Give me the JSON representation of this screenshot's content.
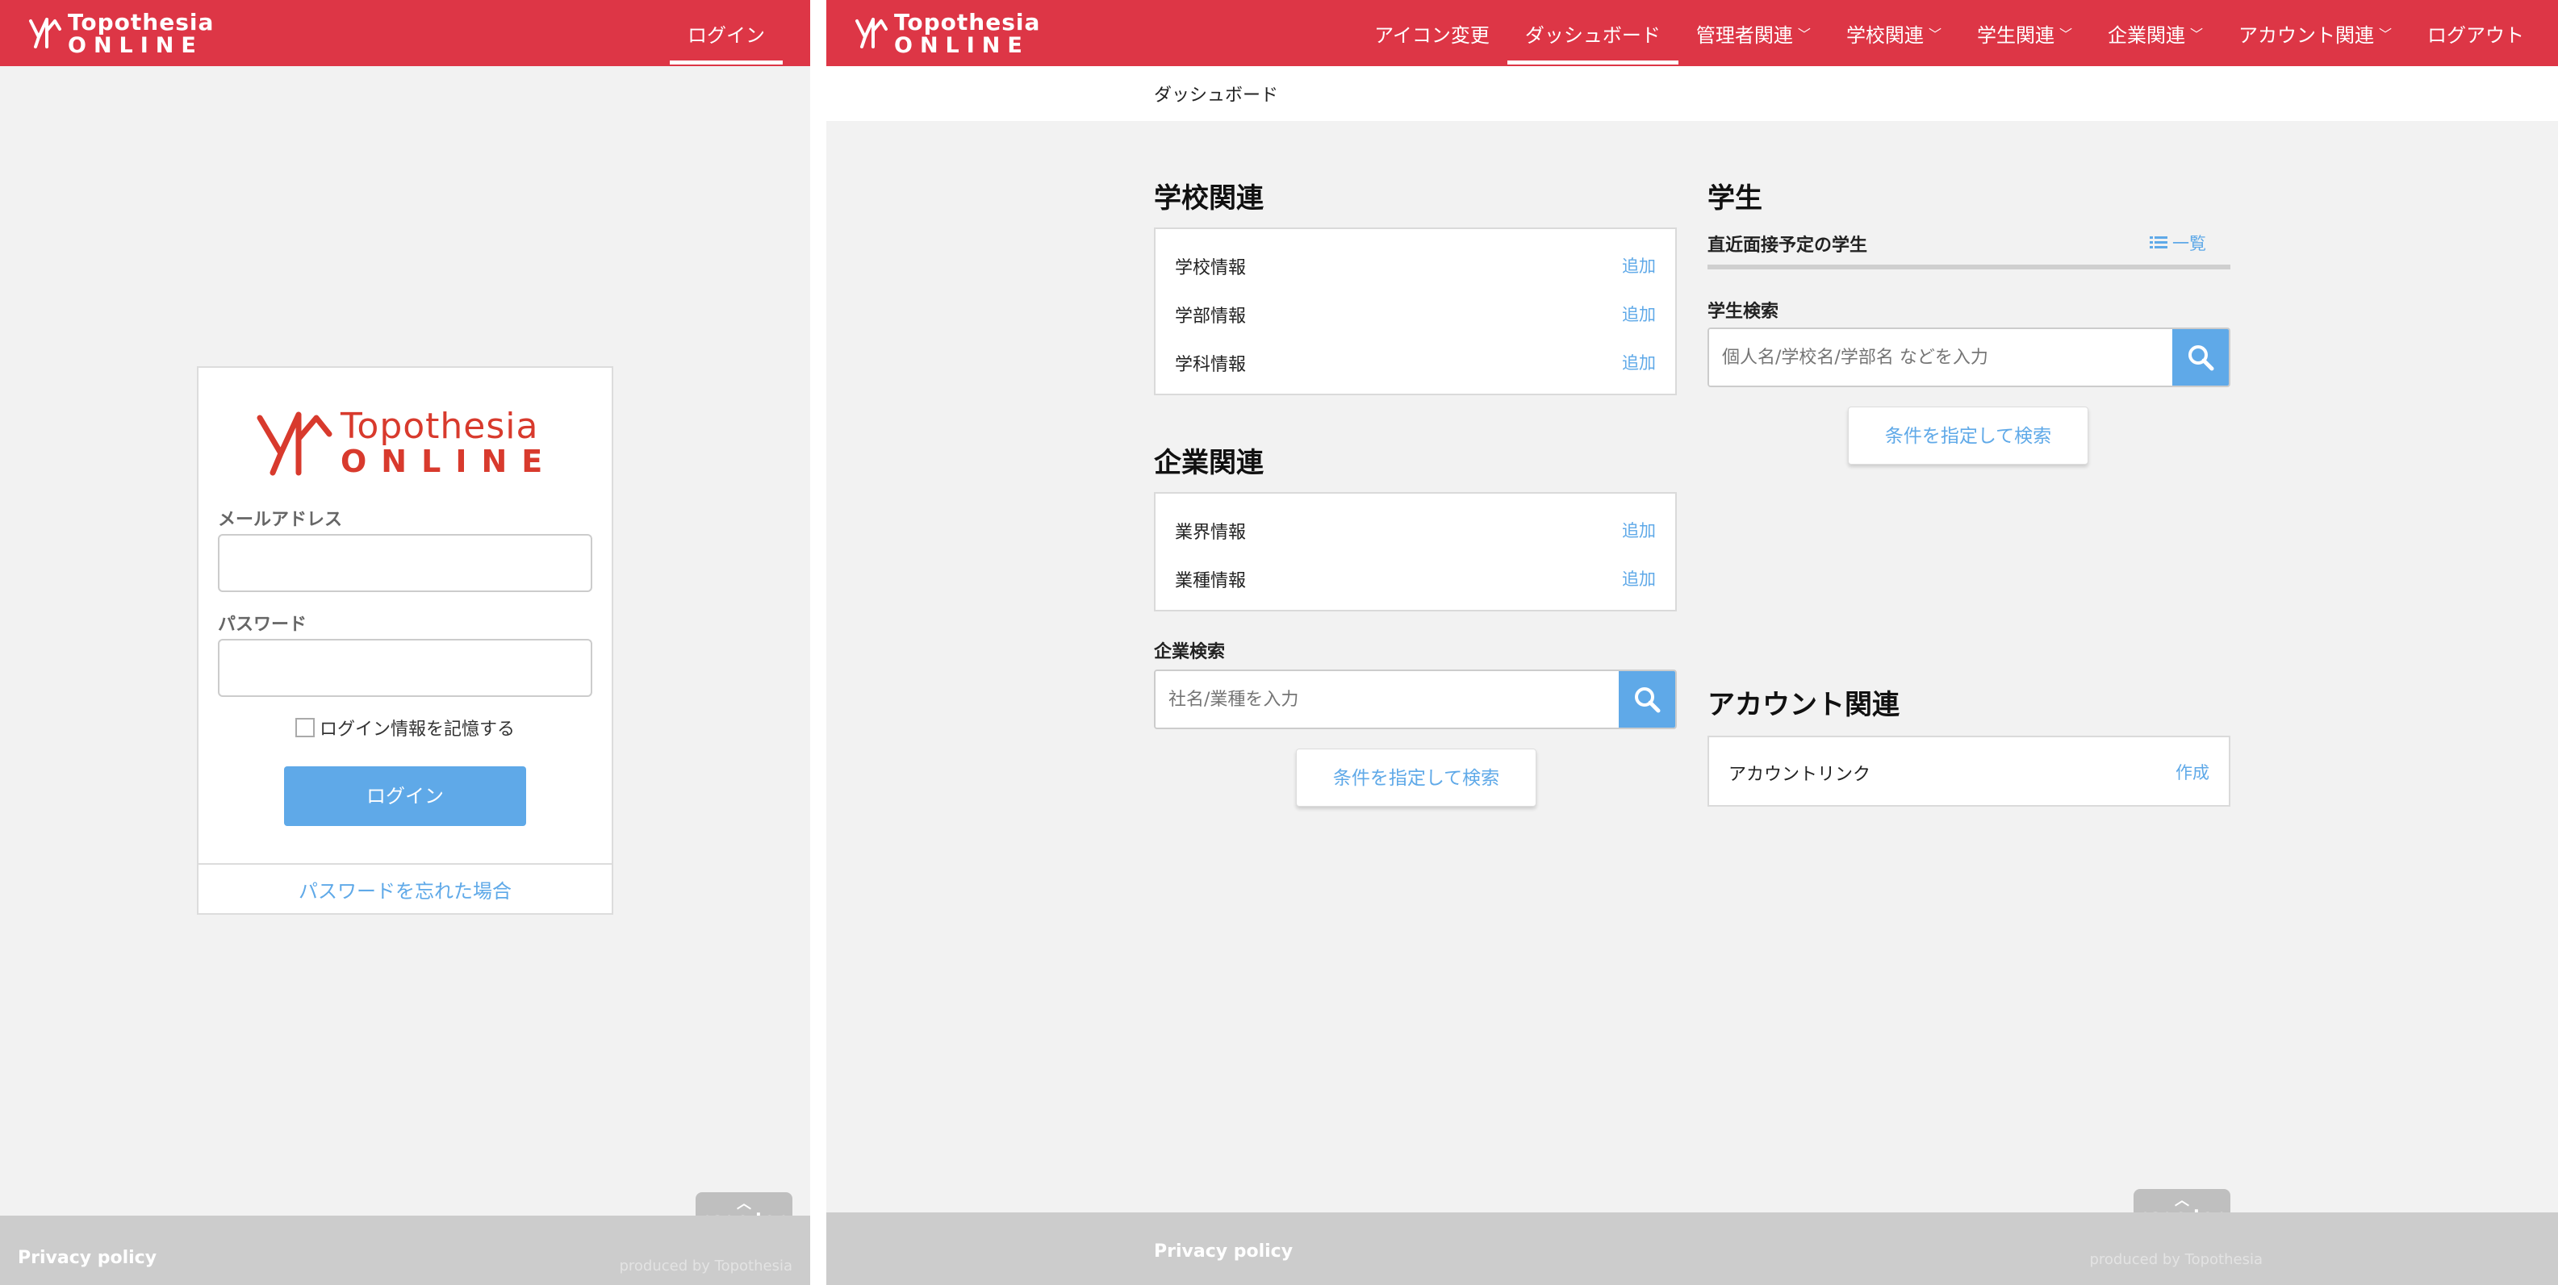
{
  "colors": {
    "brand": "#dd3646",
    "accent": "#5fa9e8",
    "background": "#f2f2f2",
    "footer": "#cccccc"
  },
  "login_page": {
    "header": {
      "logo_line1": "Topothesia",
      "logo_line2": "ONLINE",
      "nav_login": "ログイン"
    },
    "card": {
      "logo_line1": "Topothesia",
      "logo_line2": "ONLINE",
      "email_label": "メールアドレス",
      "email_value": "",
      "password_label": "パスワード",
      "password_value": "",
      "remember_label": "ログイン情報を記憶する",
      "login_button": "ログイン",
      "forgot_link": "パスワードを忘れた場合"
    },
    "page_top": "page top",
    "footer": {
      "privacy": "Privacy policy",
      "produced": "produced by Topothesia"
    }
  },
  "dashboard_page": {
    "header": {
      "logo_line1": "Topothesia",
      "logo_line2": "ONLINE",
      "nav": [
        {
          "label": "アイコン変更",
          "dropdown": false,
          "active": false
        },
        {
          "label": "ダッシュボード",
          "dropdown": false,
          "active": true
        },
        {
          "label": "管理者関連",
          "dropdown": true,
          "active": false
        },
        {
          "label": "学校関連",
          "dropdown": true,
          "active": false
        },
        {
          "label": "学生関連",
          "dropdown": true,
          "active": false
        },
        {
          "label": "企業関連",
          "dropdown": true,
          "active": false
        },
        {
          "label": "アカウント関連",
          "dropdown": true,
          "active": false
        },
        {
          "label": "ログアウト",
          "dropdown": false,
          "active": false
        }
      ]
    },
    "breadcrumb": "ダッシュボード",
    "school": {
      "title": "学校関連",
      "items": [
        {
          "label": "学校情報",
          "action": "追加"
        },
        {
          "label": "学部情報",
          "action": "追加"
        },
        {
          "label": "学科情報",
          "action": "追加"
        }
      ]
    },
    "company": {
      "title": "企業関連",
      "items": [
        {
          "label": "業界情報",
          "action": "追加"
        },
        {
          "label": "業種情報",
          "action": "追加"
        }
      ],
      "search_label": "企業検索",
      "search_placeholder": "社名/業種を入力",
      "condition_button": "条件を指定して検索"
    },
    "student": {
      "title": "学生",
      "upcoming_label": "直近面接予定の学生",
      "list_link": "一覧",
      "search_label": "学生検索",
      "search_placeholder": "個人名/学校名/学部名 などを入力",
      "condition_button": "条件を指定して検索"
    },
    "account": {
      "title": "アカウント関連",
      "items": [
        {
          "label": "アカウントリンク",
          "action": "作成"
        }
      ]
    },
    "page_top": "page top",
    "footer": {
      "privacy": "Privacy policy",
      "produced": "produced by Topothesia"
    }
  }
}
